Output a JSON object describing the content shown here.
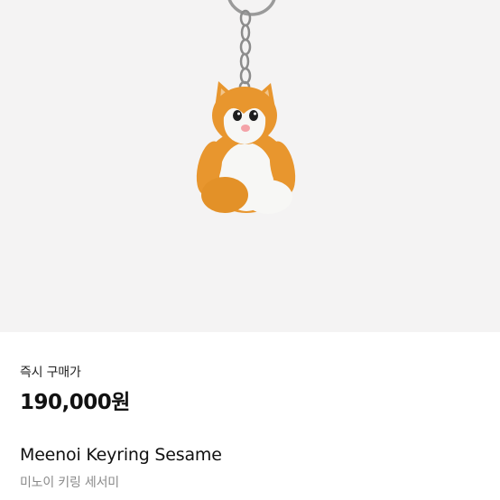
{
  "product": {
    "image_icon": "cat-keyring-figure",
    "purchase_label": "즉시 구매가",
    "price": "190,000원",
    "title_en": "Meenoi Keyring Sesame",
    "title_ko": "미노이 키링 세서미"
  },
  "colors": {
    "hero_bg": "#f4f3f3",
    "fur_orange": "#e8962e",
    "fur_white": "#f7f7f5",
    "nose_pink": "#f4a3a8"
  }
}
